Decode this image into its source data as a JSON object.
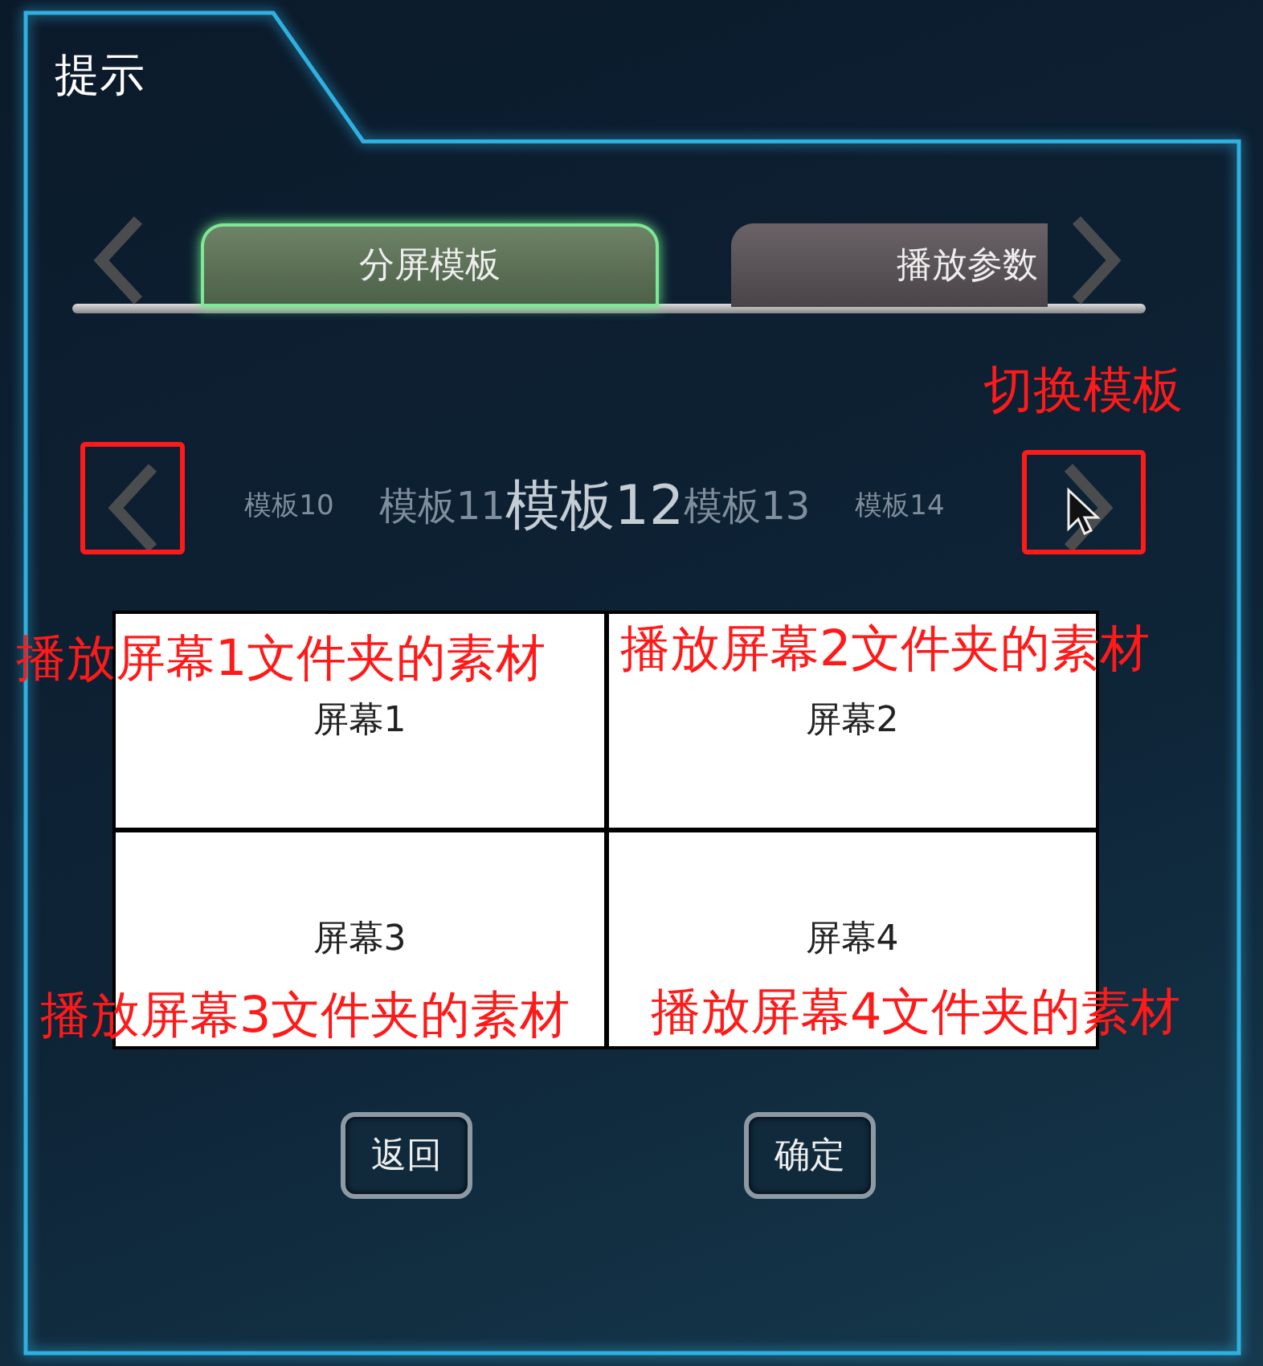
{
  "dialog": {
    "title": "提示"
  },
  "tabs": [
    {
      "label": "分屏模板",
      "selected": true
    },
    {
      "label": "播放参数",
      "selected": false
    }
  ],
  "templates": [
    {
      "label": "模板10",
      "selected": false
    },
    {
      "label": "模板11",
      "selected": false
    },
    {
      "label": "模板12",
      "selected": true
    },
    {
      "label": "模板13",
      "selected": false
    },
    {
      "label": "模板14",
      "selected": false
    }
  ],
  "screens": [
    {
      "label": "屏幕1"
    },
    {
      "label": "屏幕2"
    },
    {
      "label": "屏幕3"
    },
    {
      "label": "屏幕4"
    }
  ],
  "buttons": [
    "返回",
    "确定"
  ],
  "annotations": [
    {
      "kind": "label",
      "text": "切换模板"
    },
    {
      "kind": "box"
    },
    {
      "kind": "box"
    },
    {
      "kind": "label",
      "text": "播放屏幕1文件夹的素材"
    },
    {
      "kind": "label",
      "text": "播放屏幕2文件夹的素材"
    },
    {
      "kind": "label",
      "text": "播放屏幕3文件夹的素材"
    },
    {
      "kind": "label",
      "text": "播放屏幕4文件夹的素材"
    }
  ]
}
